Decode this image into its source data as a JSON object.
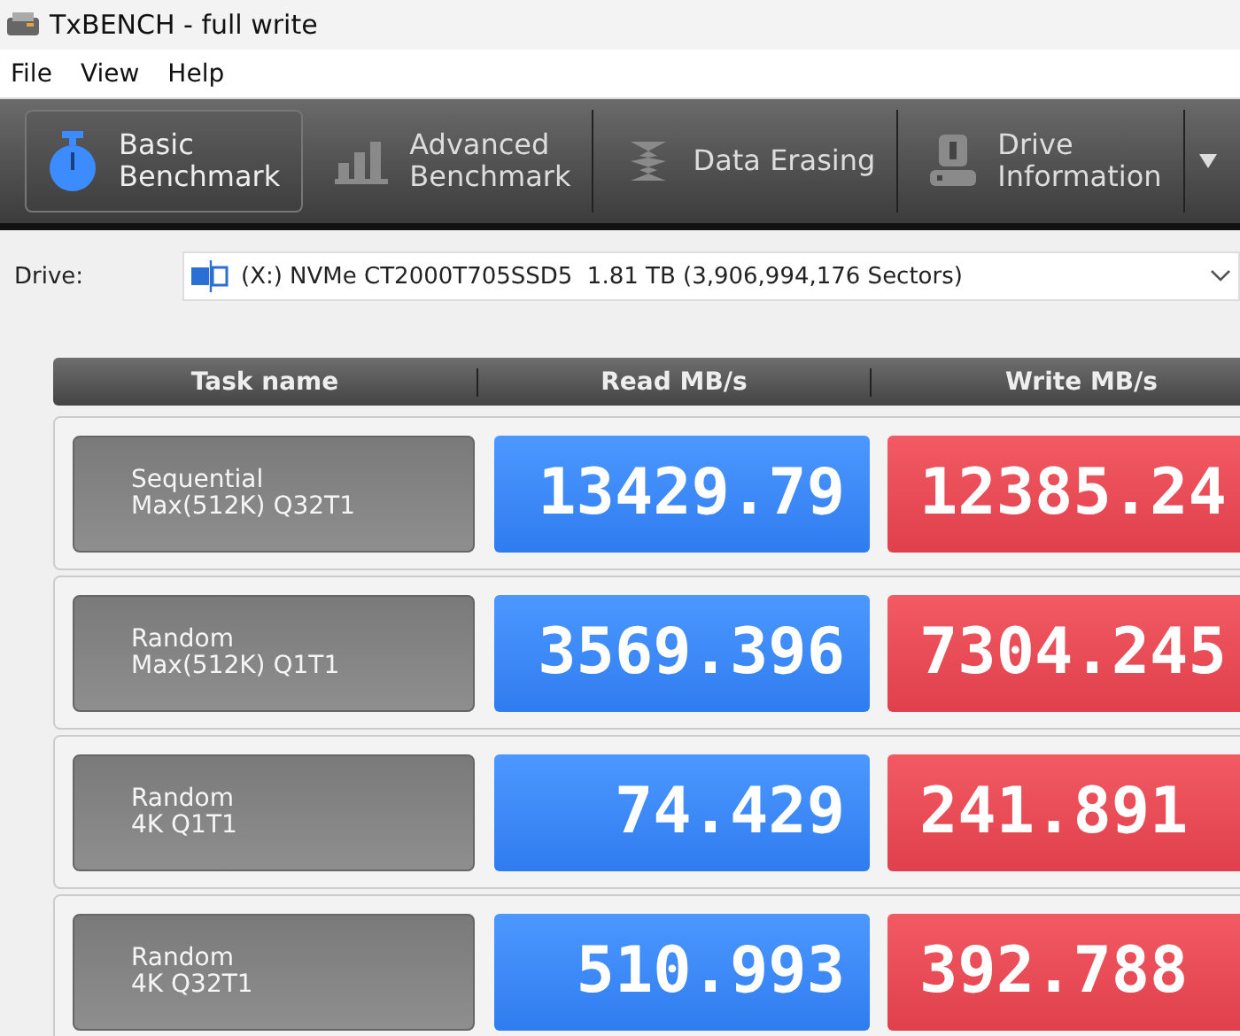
{
  "window": {
    "title": "TxBENCH - full write"
  },
  "menu": [
    "File",
    "View",
    "Help"
  ],
  "tabs": [
    {
      "label": "Basic\nBenchmark",
      "kind": "timer",
      "selected": true
    },
    {
      "label": "Advanced\nBenchmark",
      "kind": "bars",
      "selected": false
    },
    {
      "label": "Data Erasing",
      "kind": "eraser",
      "selected": false
    },
    {
      "label": "Drive\nInformation",
      "kind": "drive",
      "selected": false
    }
  ],
  "drive": {
    "label": "Drive:",
    "value": "(X:) NVMe CT2000T705SSD5  1.81 TB (3,906,994,176 Sectors)"
  },
  "table": {
    "columns": [
      "Task name",
      "Read MB/s",
      "Write MB/s"
    ],
    "rows": [
      {
        "task": "Sequential\nMax(512K) Q32T1",
        "read": "13429.79",
        "write": "12385.24"
      },
      {
        "task": "Random\nMax(512K) Q1T1",
        "read": "3569.396",
        "write": "7304.245"
      },
      {
        "task": "Random\n4K Q1T1",
        "read": "74.429",
        "write": "241.891"
      },
      {
        "task": "Random\n4K Q32T1",
        "read": "510.993",
        "write": "392.788"
      }
    ]
  }
}
